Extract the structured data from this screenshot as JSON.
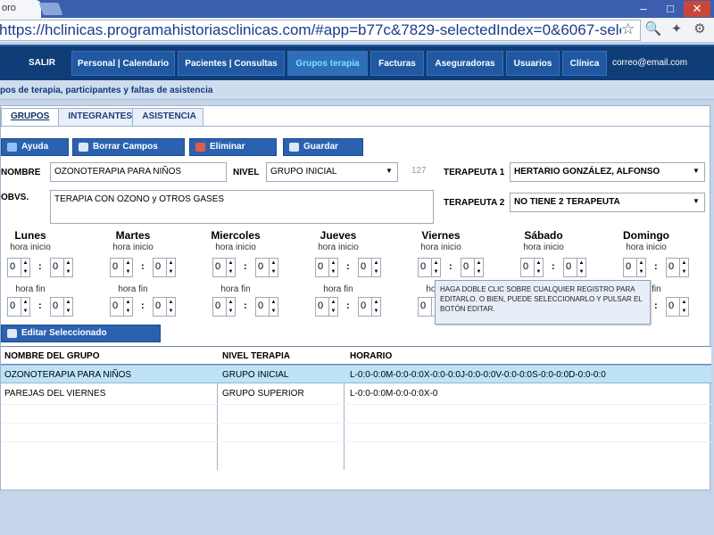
{
  "browser": {
    "tab_title": "oro",
    "url": "https://hclinicas.programahistoriasclinicas.com/#app=b77c&7829-selectedIndex=0&6067-selectedInd",
    "colors": {
      "tabstrip": "#3b5fae"
    }
  },
  "nav": {
    "salir": "SALIR",
    "items": [
      "Personal | Calendario",
      "Pacientes | Consultas",
      "Grupos terapia",
      "Facturas",
      "Aseguradoras",
      "Usuarios",
      "Clínica"
    ],
    "active": "Grupos terapia",
    "email": "correo@email.com",
    "colors": {
      "bar": "#0f3d78",
      "active_text": "#7be0ff"
    }
  },
  "subtitle": "pos de terapia, participantes y faltas de asistencia",
  "tabs": [
    "GRUPOS",
    "INTEGRANTES",
    "ASISTENCIA"
  ],
  "buttons": {
    "ayuda": "Ayuda",
    "borrar": "Borrar Campos",
    "eliminar": "Eliminar",
    "guardar": "Guardar",
    "editar": "Editar Seleccionado"
  },
  "form": {
    "nombre_label": "NOMBRE",
    "nombre_value": "OZONOTERAPIA PARA NIÑOS",
    "nivel_label": "NIVEL",
    "nivel_value": "GRUPO INICIAL",
    "id_value": "127",
    "terapeuta1_label": "TERAPEUTA 1",
    "terapeuta1_value": "HERTARIO GONZÁLEZ, ALFONSO",
    "obvs_label": "OBVS.",
    "obvs_value": "TERAPIA CON OZONO y OTROS GASES",
    "terapeuta2_label": "TERAPEUTA 2",
    "terapeuta2_value": "NO TIENE 2 TERAPEUTA"
  },
  "schedule": {
    "hora_inicio": "hora inicio",
    "hora_fin": "hora fin",
    "days": [
      {
        "name": "Lunes",
        "start_h": "0",
        "start_m": "0",
        "end_h": "0",
        "end_m": "0"
      },
      {
        "name": "Martes",
        "start_h": "0",
        "start_m": "0",
        "end_h": "0",
        "end_m": "0"
      },
      {
        "name": "Miercoles",
        "start_h": "0",
        "start_m": "0",
        "end_h": "0",
        "end_m": "0"
      },
      {
        "name": "Jueves",
        "start_h": "0",
        "start_m": "0",
        "end_h": "0",
        "end_m": "0"
      },
      {
        "name": "Viernes",
        "start_h": "0",
        "start_m": "0",
        "end_h": "0",
        "end_m": "0"
      },
      {
        "name": "Sábado",
        "start_h": "0",
        "start_m": "0",
        "end_h": "0",
        "end_m": "0"
      },
      {
        "name": "Domingo",
        "start_h": "0",
        "start_m": "0",
        "end_h": "0",
        "end_m": "0"
      }
    ]
  },
  "grid": {
    "headers": [
      "NOMBRE DEL GRUPO",
      "NIVEL TERAPIA",
      "HORARIO"
    ],
    "rows": [
      [
        "OZONOTERAPIA PARA NIÑOS",
        "GRUPO INICIAL",
        "L-0:0-0:0M-0:0-0:0X-0:0-0:0J-0:0-0:0V-0:0-0:0S-0:0-0:0D-0:0-0:0"
      ],
      [
        "PAREJAS DEL VIERNES",
        "GRUPO SUPERIOR",
        "L-0:0-0:0M-0:0-0:0X-0"
      ]
    ],
    "selected_row": 0,
    "tooltip": "HAGA DOBLE CLIC SOBRE CUALQUIER REGISTRO PARA EDITARLO. O BIEN, PUEDE SELECCIONARLO Y PULSAR EL BOTÓN EDITAR."
  }
}
